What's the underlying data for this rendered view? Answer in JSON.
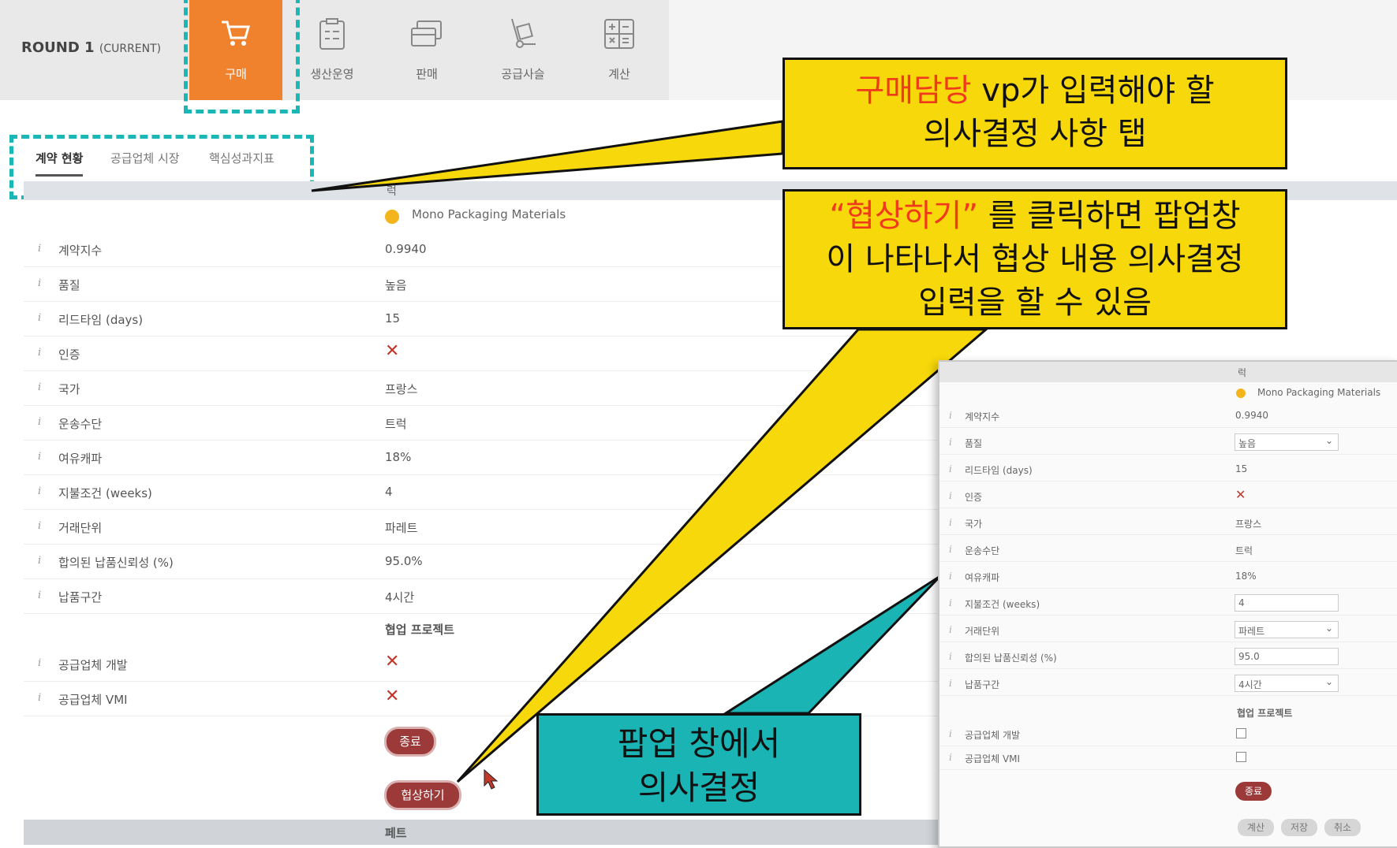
{
  "round": {
    "label": "ROUND 1",
    "state": "(CURRENT)"
  },
  "nav_tabs": [
    {
      "label": "구매",
      "icon": "cart-icon",
      "active": true
    },
    {
      "label": "생산운영",
      "icon": "clipboard-icon"
    },
    {
      "label": "판매",
      "icon": "cards-icon"
    },
    {
      "label": "공급사슬",
      "icon": "hand-truck-icon"
    },
    {
      "label": "계산",
      "icon": "calculator-icon"
    }
  ],
  "sub_tabs": [
    "계약 현황",
    "공급업체 시장",
    "핵심성과지표"
  ],
  "header_char": "럭",
  "supplier_name": "Mono Packaging Materials",
  "rows": [
    {
      "label": "계약지수",
      "value": "0.9940"
    },
    {
      "label": "품질",
      "value": "높음"
    },
    {
      "label": "리드타임 (days)",
      "value": "15"
    },
    {
      "label": "인증",
      "value": "✕"
    },
    {
      "label": "국가",
      "value": "프랑스"
    },
    {
      "label": "운송수단",
      "value": "트럭"
    },
    {
      "label": "여유캐파",
      "value": "18%"
    },
    {
      "label": "지불조건 (weeks)",
      "value": "4"
    },
    {
      "label": "거래단위",
      "value": "파레트"
    },
    {
      "label": "합의된 납품신뢰성 (%)",
      "value": "95.0%"
    },
    {
      "label": "납품구간",
      "value": "4시간"
    }
  ],
  "collab_section": "협업 프로젝트",
  "collab_rows": [
    {
      "label": "공급업체 개발",
      "value": "✕"
    },
    {
      "label": "공급업체 VMI",
      "value": "✕"
    }
  ],
  "buttons": {
    "end": "종료",
    "negotiate": "협상하기"
  },
  "footer_label": "페트",
  "info_glyph": "i",
  "callouts": {
    "top_red": "구매담당",
    "top_rest1": " vp가 입력해야 할",
    "top_line2": "의사결정 사항 탭",
    "mid_red": "“협상하기”",
    "mid_rest1": " 를 클릭하면 팝업창",
    "mid_line2": "이 나타나서 협상 내용 의사결정",
    "mid_line3": "입력을 할 수 있음",
    "teal_line1": "팝업 창에서",
    "teal_line2": "의사결정"
  },
  "popup": {
    "header_char": "럭",
    "supplier_name": "Mono Packaging Materials",
    "rows": [
      {
        "label": "계약지수",
        "value": "0.9940",
        "kind": "text"
      },
      {
        "label": "품질",
        "value": "높음",
        "kind": "select"
      },
      {
        "label": "리드타임 (days)",
        "value": "15",
        "kind": "text"
      },
      {
        "label": "인증",
        "value": "✕",
        "kind": "x"
      },
      {
        "label": "국가",
        "value": "프랑스",
        "kind": "text"
      },
      {
        "label": "운송수단",
        "value": "트럭",
        "kind": "text"
      },
      {
        "label": "여유캐파",
        "value": "18%",
        "kind": "text"
      },
      {
        "label": "지불조건 (weeks)",
        "value": "4",
        "kind": "input"
      },
      {
        "label": "거래단위",
        "value": "파레트",
        "kind": "select"
      },
      {
        "label": "합의된 납품신뢰성 (%)",
        "value": "95.0",
        "kind": "input"
      },
      {
        "label": "납품구간",
        "value": "4시간",
        "kind": "select"
      }
    ],
    "collab_section": "협업 프로젝트",
    "collab_rows": [
      {
        "label": "공급업체 개발"
      },
      {
        "label": "공급업체 VMI"
      }
    ],
    "end_button": "종료",
    "bottom_buttons": [
      "계산",
      "저장",
      "취소"
    ]
  },
  "colors": {
    "accent_orange": "#f0822e",
    "dash_teal": "#19b7b5",
    "button_red": "#9c3a3a",
    "callout_yellow": "#f7d80a",
    "callout_teal": "#1ab4b4",
    "red_text": "#f03a1c"
  }
}
